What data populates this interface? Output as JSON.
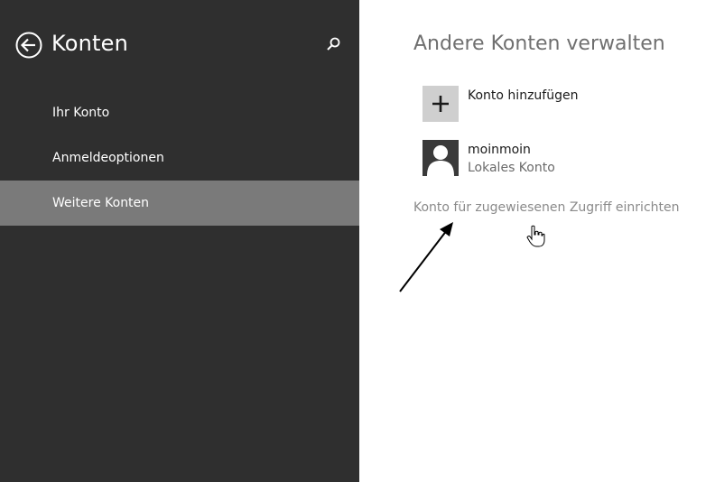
{
  "sidebar": {
    "title": "Konten",
    "items": [
      {
        "label": "Ihr Konto",
        "active": false
      },
      {
        "label": "Anmeldeoptionen",
        "active": false
      },
      {
        "label": "Weitere Konten",
        "active": true
      }
    ],
    "background_color": "#2f2f2f",
    "active_item_color": "#7a7a7a"
  },
  "icons": {
    "back": "back-arrow-circle-icon",
    "search": "search-icon",
    "add": "plus-icon",
    "user": "user-avatar-icon",
    "annotation_arrow": "arrow-icon",
    "cursor": "hand-pointer-icon"
  },
  "main": {
    "title": "Andere Konten verwalten",
    "add_account": {
      "label": "Konto hinzufügen"
    },
    "accounts": [
      {
        "name": "moinmoin",
        "type": "Lokales Konto"
      }
    ],
    "assigned_access_link": "Konto für zugewiesenen Zugriff einrichten"
  }
}
